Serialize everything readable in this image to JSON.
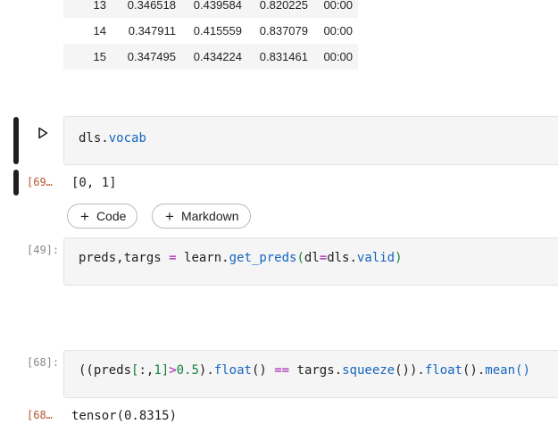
{
  "table": {
    "rows": [
      [
        "13",
        "0.346518",
        "0.439584",
        "0.820225",
        "00:00"
      ],
      [
        "14",
        "0.347911",
        "0.415559",
        "0.837079",
        "00:00"
      ],
      [
        "15",
        "0.347495",
        "0.434224",
        "0.831461",
        "00:00"
      ]
    ]
  },
  "cells": {
    "vocab": {
      "tokens": [
        "dls",
        ".",
        "vocab"
      ],
      "output_prompt": "[69…",
      "output": "[0, 1]"
    },
    "preds": {
      "prompt": "[49]:",
      "tokens": [
        "preds,targs ",
        "=",
        " learn.",
        "get_preds",
        "(",
        "dl",
        "=",
        "dls.",
        "valid",
        ")"
      ]
    },
    "acc": {
      "prompt": "[68]:",
      "tokens": [
        "((preds",
        "[",
        ":,",
        "1",
        "]",
        ">",
        "0.5",
        ").",
        "float",
        "() ",
        "==",
        " targs.",
        "squeeze",
        "()).",
        "float",
        "().",
        "mean",
        "()"
      ],
      "output_prompt": "[68…",
      "output": "tensor(0.8315)"
    }
  },
  "add_buttons": {
    "code": "Code",
    "markdown": "Markdown"
  },
  "icons": {
    "run": "play-outline-icon",
    "plus": "plus-icon"
  }
}
